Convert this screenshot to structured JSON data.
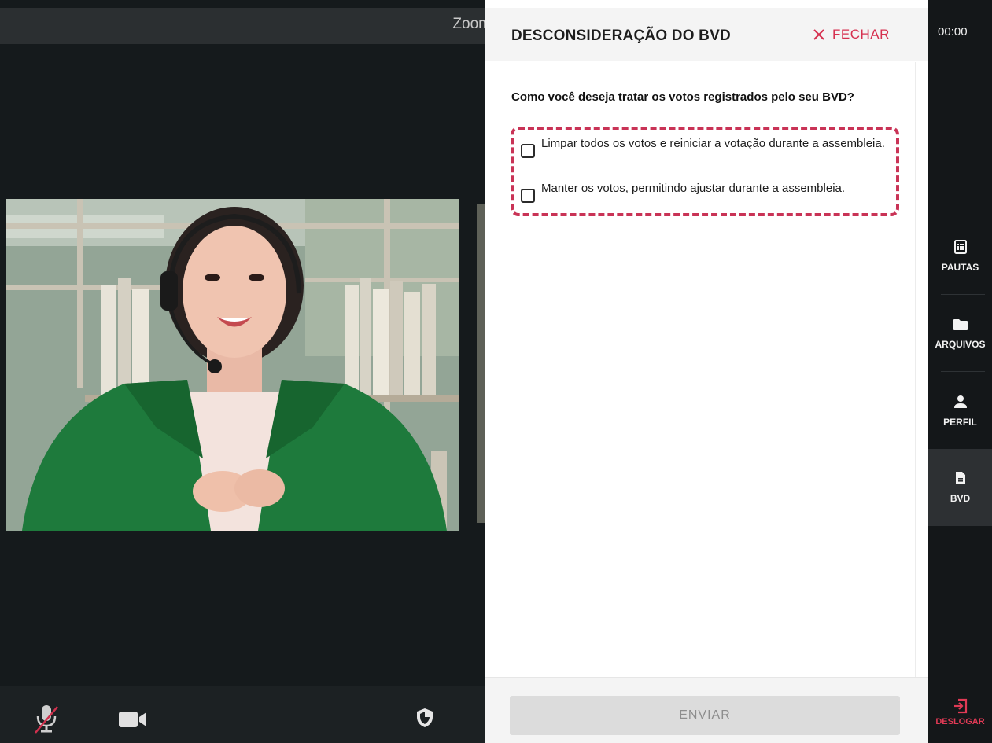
{
  "video": {
    "window_title": "Zoom"
  },
  "panel": {
    "title": "DESCONSIDERAÇÃO DO BVD",
    "close_label": "FECHAR",
    "question": "Como você deseja tratar os votos registrados pelo seu BVD?",
    "options": [
      {
        "label": "Limpar todos os votos e reiniciar a votação durante a assembleia.",
        "checked": false
      },
      {
        "label": "Manter os votos, permitindo ajustar durante a assembleia.",
        "checked": false
      }
    ],
    "submit_label": "ENVIAR"
  },
  "sidebar": {
    "clock": "00:00",
    "items": [
      {
        "label": "PAUTAS",
        "icon": "list-icon"
      },
      {
        "label": "ARQUIVOS",
        "icon": "folder-icon"
      },
      {
        "label": "PERFIL",
        "icon": "person-icon"
      },
      {
        "label": "BVD",
        "icon": "document-icon",
        "active": true
      }
    ],
    "logout_label": "DESLOGAR"
  },
  "colors": {
    "accent": "#d6304f",
    "highlight_dash": "#c93356",
    "sidebar_bg": "#141719"
  }
}
